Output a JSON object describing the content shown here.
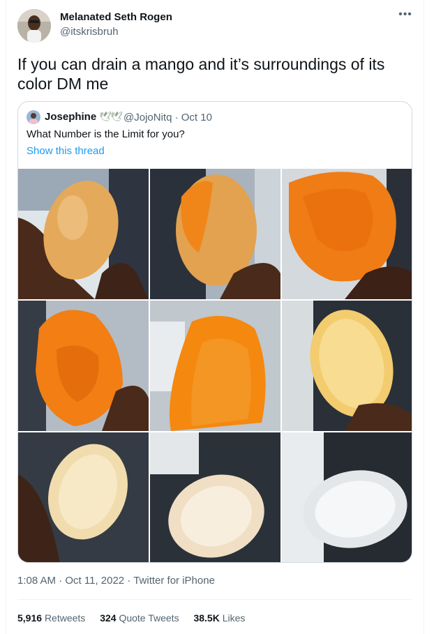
{
  "tweet": {
    "author_name": "Melanated Seth Rogen",
    "author_handle": "@itskrisbruh",
    "text": "If you can drain a mango and it’s surroundings of its color DM me",
    "more_icon": "more-horizontal-icon",
    "timestamp": "1:08 AM · Oct 11, 2022 · Twitter for iPhone"
  },
  "quote": {
    "name": "Josephine",
    "emoji_1": "🕊",
    "emoji_2": "🕊",
    "handle_date": "@JojoNitq · Oct 10",
    "text": "What Number is the Limit for you?",
    "show_thread": "Show this thread"
  },
  "stats": {
    "retweets_count": "5,916",
    "retweets_label": "Retweets",
    "quotes_count": "324",
    "quotes_label": "Quote Tweets",
    "likes_count": "38.5K",
    "likes_label": "Likes"
  },
  "colors": {
    "text_primary": "#0f1419",
    "text_secondary": "#536471",
    "link": "#1d9bf0",
    "border": "#cfd9de"
  }
}
